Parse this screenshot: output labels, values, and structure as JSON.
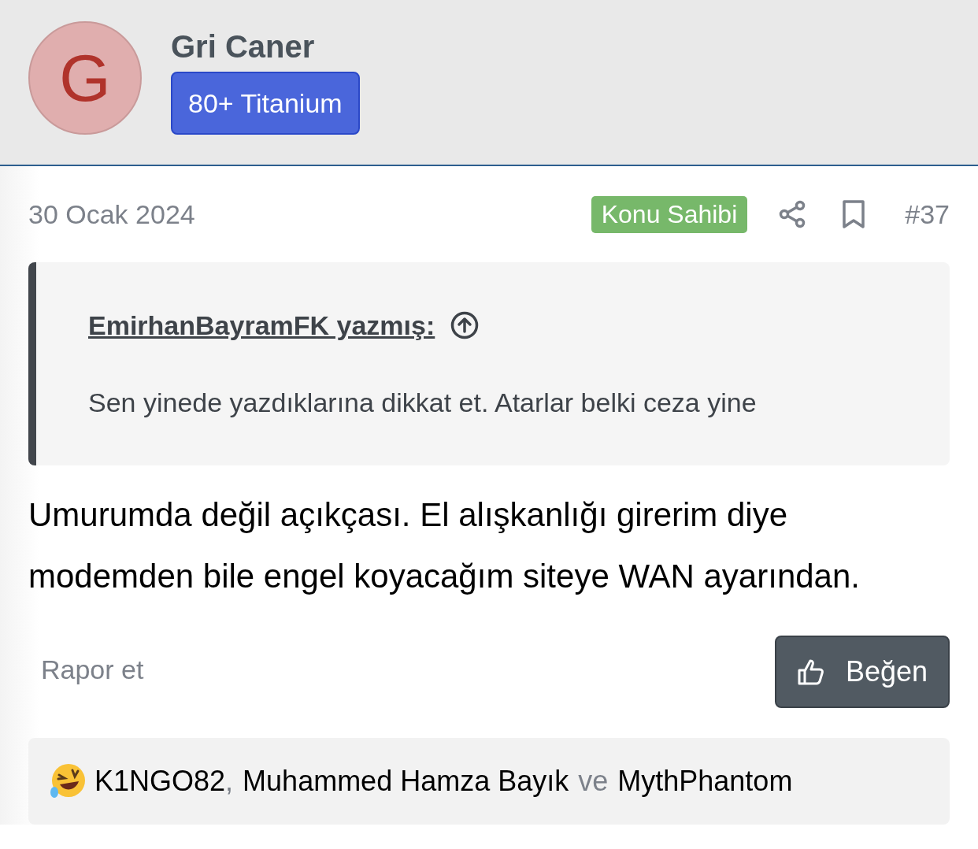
{
  "author": {
    "initial": "G",
    "name": "Gri Caner",
    "badge": "80+ Titanium"
  },
  "post": {
    "date": "30 Ocak 2024",
    "owner_badge": "Konu Sahibi",
    "number": "#37"
  },
  "quote": {
    "author": "EmirhanBayramFK yazmış:",
    "text": "Sen yinede yazdıklarına dikkat et. Atarlar belki ceza yine"
  },
  "body": [
    "Umurumda değil açıkçası. El alışkanlığı girerim diye",
    "modemden bile engel koyacağım siteye WAN ayarından."
  ],
  "actions": {
    "report": "Rapor et",
    "like": "Beğen"
  },
  "reactions": {
    "users": [
      "K1NGO82",
      "Muhammed Hamza Bayık",
      "MythPhantom"
    ],
    "separators": [
      ",",
      "ve"
    ]
  }
}
